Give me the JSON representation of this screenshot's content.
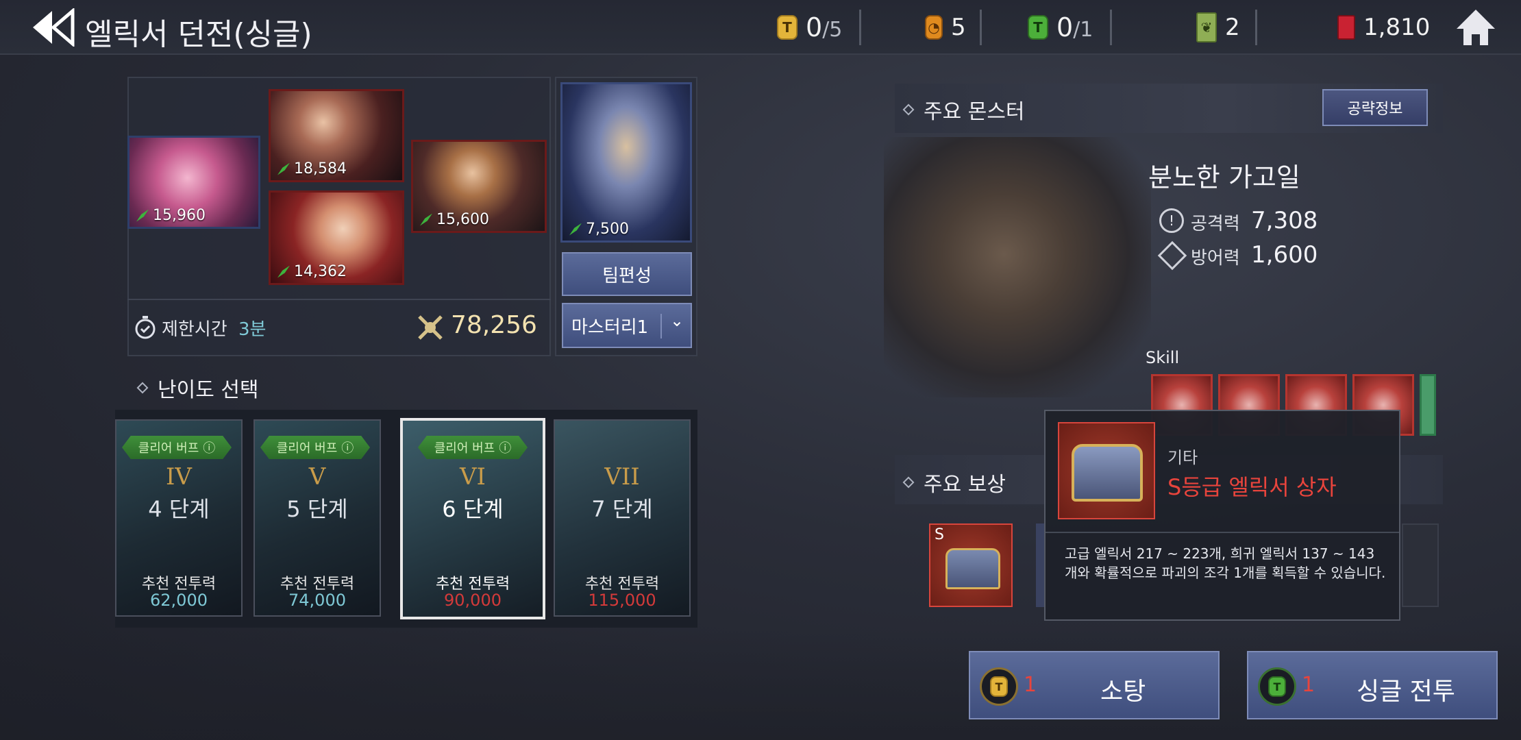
{
  "header": {
    "title": "엘릭서 던전(싱글)",
    "resources": [
      {
        "icon": "gold-ticket-icon",
        "value": "0",
        "max": "/5"
      },
      {
        "icon": "orange-ticket-icon",
        "value": "5"
      },
      {
        "icon": "green-ticket-icon",
        "value": "0",
        "max": "/1"
      },
      {
        "icon": "green-card-icon",
        "value": "2"
      },
      {
        "icon": "red-gem-icon",
        "value": "1,810"
      }
    ]
  },
  "team": {
    "heroes": [
      {
        "power": "15,960"
      },
      {
        "power": "18,584"
      },
      {
        "power": "14,362"
      },
      {
        "power": "15,600"
      }
    ],
    "leader": {
      "power": "7,500"
    },
    "time_limit_label": "제한시간",
    "time_limit_value": "3분",
    "total_power": "78,256",
    "edit_team_label": "팀편성",
    "mastery_label": "마스터리1"
  },
  "difficulty": {
    "title": "난이도 선택",
    "buff_label": "클리어 버프",
    "rec_label": "추천 전투력",
    "levels": [
      {
        "roman": "IV",
        "stage": "4 단계",
        "power": "62,000"
      },
      {
        "roman": "V",
        "stage": "5 단계",
        "power": "74,000"
      },
      {
        "roman": "VI",
        "stage": "6 단계",
        "power": "90,000"
      },
      {
        "roman": "VII",
        "stage": "7 단계",
        "power": "115,000"
      }
    ]
  },
  "monster": {
    "section_title": "주요 몬스터",
    "strategy_button": "공략정보",
    "name": "분노한 가고일",
    "attack_label": "공격력",
    "attack_value": "7,308",
    "defense_label": "방어력",
    "defense_value": "1,600",
    "skill_label": "Skill"
  },
  "rewards": {
    "section_title": "주요 보상",
    "first_grade": "S"
  },
  "tooltip": {
    "category": "기타",
    "name": "S등급 엘릭서 상자",
    "description": "고급 엘릭서 217 ~ 223개, 희귀 엘릭서 137 ~ 143개와 확률적으로 파괴의 조각 1개를 획득할 수 있습니다."
  },
  "actions": {
    "sweep_label": "소탕",
    "sweep_cost": "1",
    "battle_label": "싱글 전투",
    "battle_cost": "1"
  },
  "colors": {
    "rec_normal": "#7fc9d6",
    "rec_hard": "#d43a3a",
    "accent_red": "#e8443c"
  }
}
